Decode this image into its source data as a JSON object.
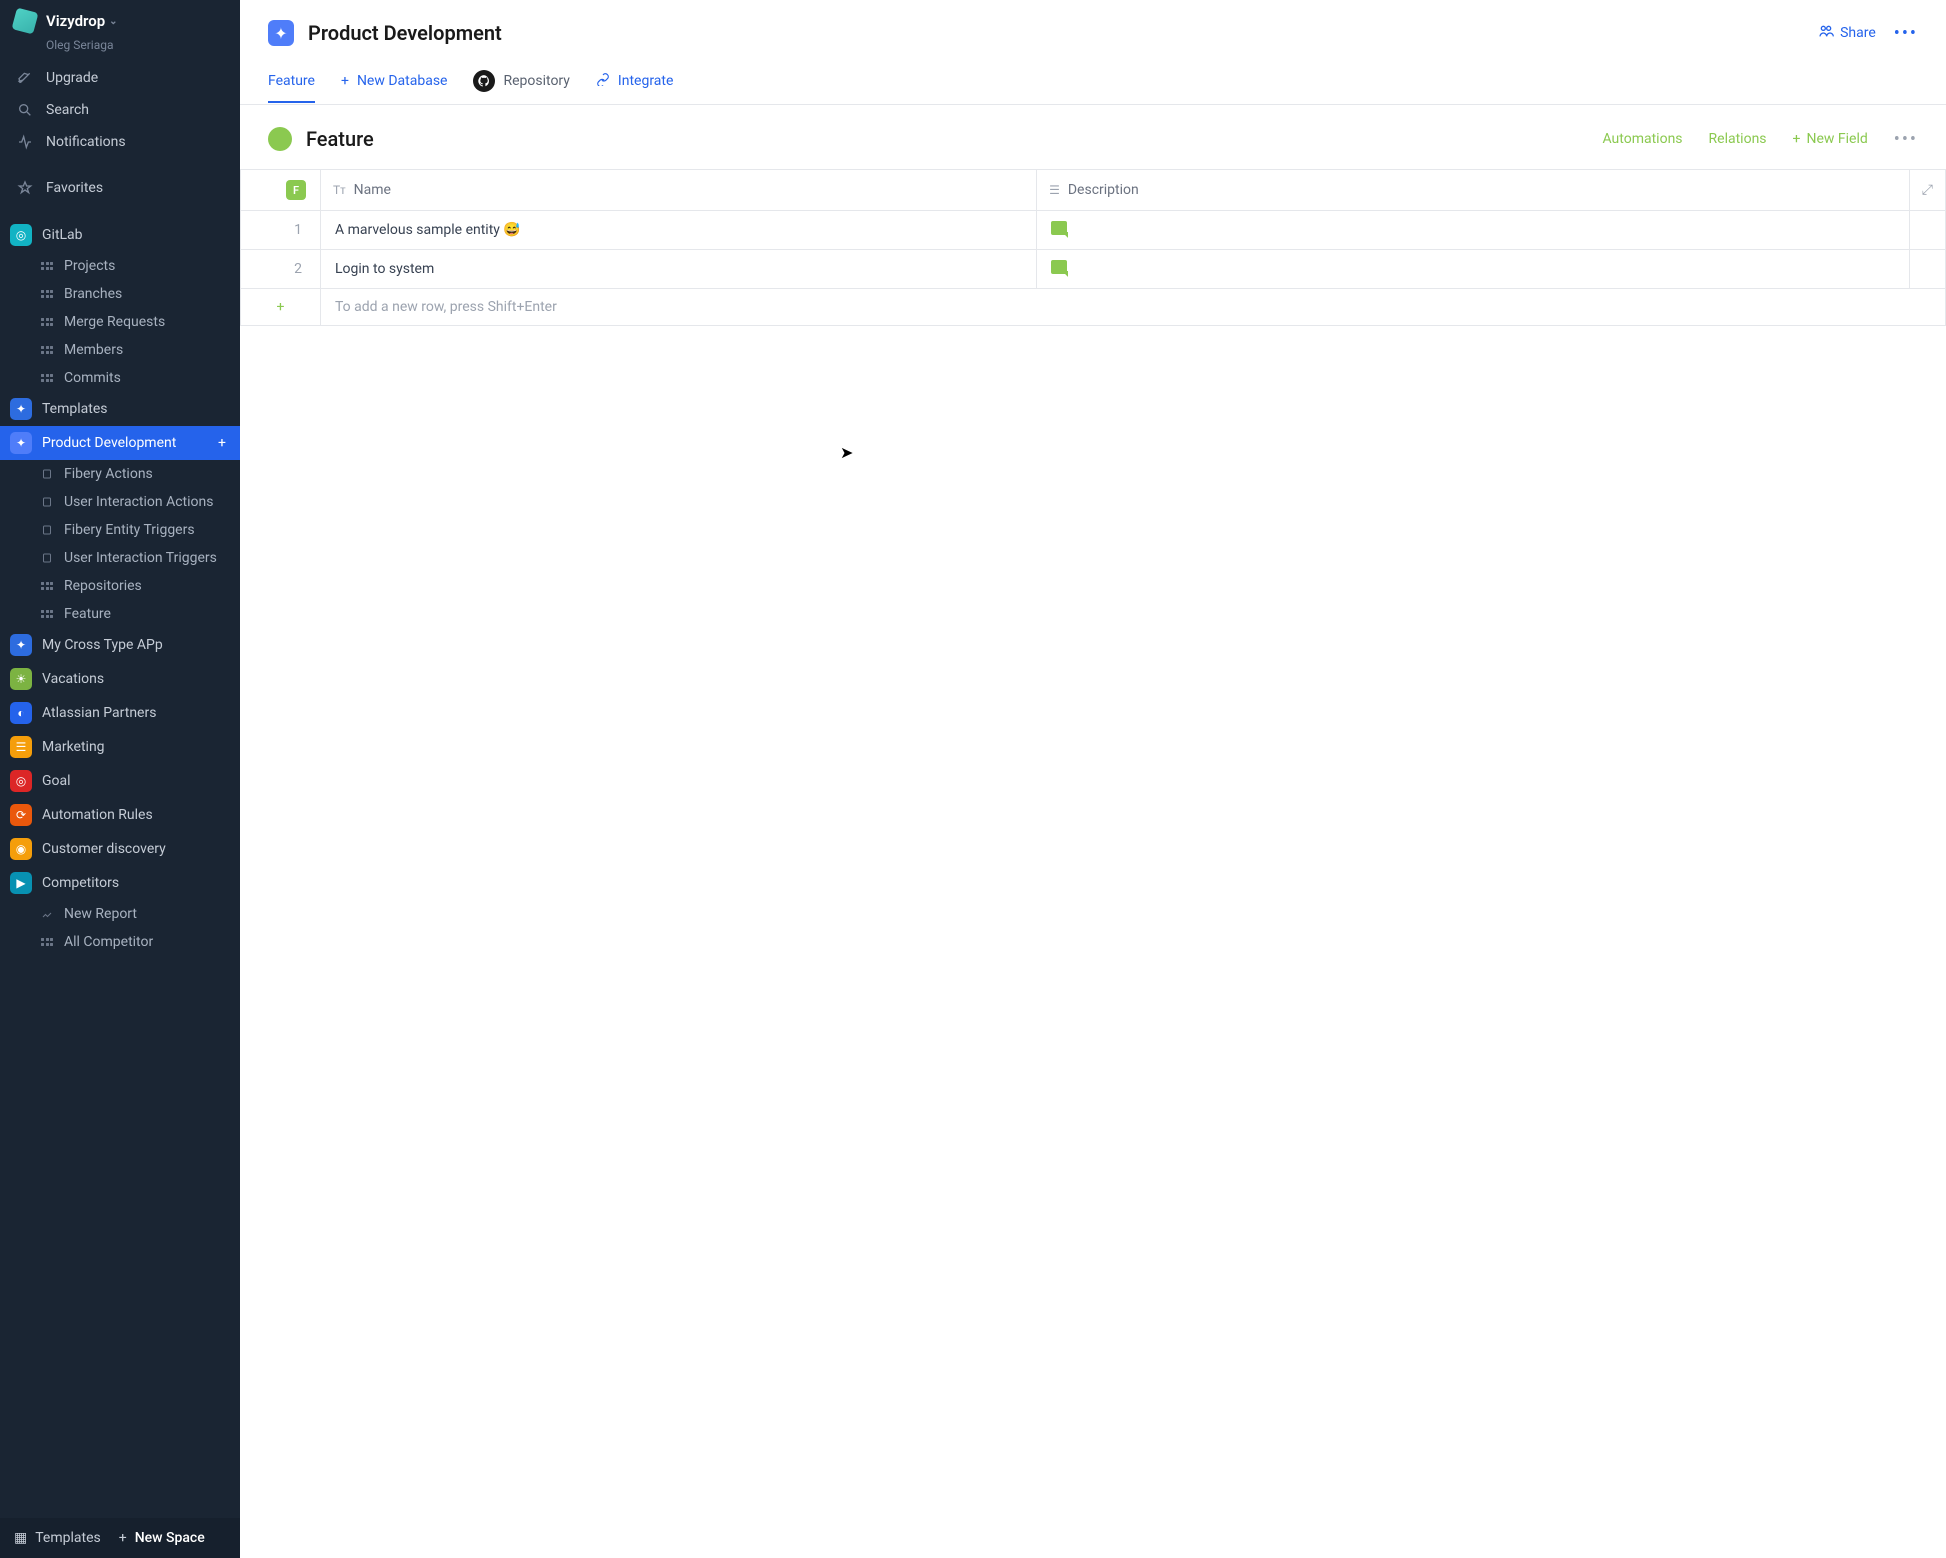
{
  "workspace": {
    "name": "Vizydrop",
    "user": "Oleg Seriaga"
  },
  "nav": {
    "upgrade": "Upgrade",
    "search": "Search",
    "notifications": "Notifications",
    "favorites": "Favorites"
  },
  "spaces": {
    "gitlab": {
      "label": "GitLab",
      "items": [
        "Projects",
        "Branches",
        "Merge Requests",
        "Members",
        "Commits"
      ]
    },
    "templates": "Templates",
    "product_dev": {
      "label": "Product Development",
      "items": [
        "Fibery Actions",
        "User Interaction Actions",
        "Fibery Entity Triggers",
        "User Interaction Triggers",
        "Repositories",
        "Feature"
      ]
    },
    "my_cross": "My Cross Type APp",
    "vacations": "Vacations",
    "atlassian": "Atlassian Partners",
    "marketing": "Marketing",
    "goal": "Goal",
    "automation_rules": "Automation Rules",
    "customer_discovery": "Customer discovery",
    "competitors": {
      "label": "Competitors",
      "items": [
        "New Report",
        "All Competitor"
      ]
    }
  },
  "footer": {
    "templates": "Templates",
    "new_space": "New Space"
  },
  "page": {
    "title": "Product Development",
    "share": "Share",
    "tabs": {
      "feature": "Feature",
      "new_db": "New Database",
      "repository": "Repository",
      "integrate": "Integrate"
    }
  },
  "db": {
    "title": "Feature",
    "actions": {
      "automations": "Automations",
      "relations": "Relations",
      "new_field": "New Field"
    },
    "columns": {
      "name": "Name",
      "description": "Description"
    },
    "rows": [
      {
        "idx": "1",
        "name": "A marvelous sample entity 😅"
      },
      {
        "idx": "2",
        "name": "Login to system"
      }
    ],
    "add_row_hint": "To add a new row, press Shift+Enter",
    "badge": "F"
  }
}
